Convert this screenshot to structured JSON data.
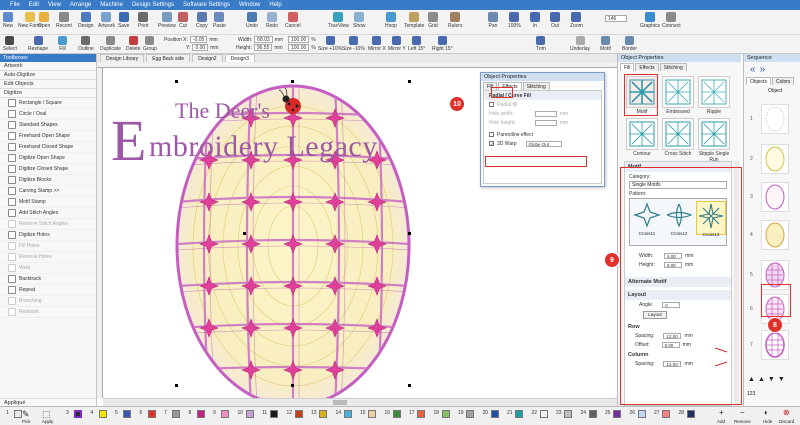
{
  "menubar": [
    "File",
    "Edit",
    "View",
    "Arrange",
    "Machine",
    "Design Settings",
    "Software Settings",
    "Window",
    "Help"
  ],
  "toolbar1": {
    "buttons": [
      "New",
      "New Form",
      "Open",
      "Recent",
      "Design",
      "Artwork",
      "Save",
      "Print",
      "Preview",
      "Cut",
      "Copy",
      "Paste",
      "Undo",
      "Redo",
      "Cancel",
      "TrueView",
      "Show",
      "Hoop",
      "Template",
      "Grid",
      "Rulers",
      "Pan",
      "100%",
      "In",
      "Out",
      "Zoom",
      "Graphics",
      "Connect"
    ],
    "zoom_value": "146"
  },
  "toolbar2": {
    "buttons": [
      "Select",
      "Reshape",
      "Fill",
      "Outline",
      "Duplicate",
      "Delete",
      "Group",
      "Size +10%",
      "Size -10%",
      "Mirror X",
      "Mirror Y",
      "Left 15°",
      "Right 15°",
      "Trim",
      "Underlay",
      "Motif",
      "Border"
    ],
    "position_x_label": "Position X:",
    "position_x": "-0.05",
    "position_y_label": "Y:",
    "position_y": "0.00",
    "width_label": "Width:",
    "width": "68.03",
    "height_label": "Height:",
    "height": "96.55",
    "unit": "mm",
    "scale_w": "100.00",
    "scale_h": "100.00",
    "scale_unit": "%"
  },
  "toolbox": {
    "title": "Toolboxes",
    "sections": [
      "Artwork",
      "Auto-Digitize",
      "Edit Objects",
      "Digitize"
    ],
    "items": [
      {
        "label": "Rectangle / Square",
        "disabled": false
      },
      {
        "label": "Circle / Oval",
        "disabled": false
      },
      {
        "label": "Standard Shapes",
        "disabled": false
      },
      {
        "label": "Freehand Open Shape",
        "disabled": false
      },
      {
        "label": "Freehand Closed Shape",
        "disabled": false
      },
      {
        "label": "Digitize Open Shape",
        "disabled": false
      },
      {
        "label": "Digitize Closed Shape",
        "disabled": false
      },
      {
        "label": "Digitize Blocks",
        "disabled": false
      },
      {
        "label": "Carving Stamp >>",
        "disabled": false
      },
      {
        "label": "Motif Stamp",
        "disabled": false
      },
      {
        "label": "Add Stitch Angles",
        "disabled": false
      },
      {
        "label": "Remove Stitch Angles",
        "disabled": true
      },
      {
        "label": "Digitize Holes",
        "disabled": false
      },
      {
        "label": "Fill Holes",
        "disabled": true
      },
      {
        "label": "Remove Holes",
        "disabled": true
      },
      {
        "label": "Weld",
        "disabled": true
      },
      {
        "label": "Backtrack",
        "disabled": false
      },
      {
        "label": "Repeat",
        "disabled": false
      },
      {
        "label": "Branching",
        "disabled": true
      },
      {
        "label": "Redwork",
        "disabled": true
      }
    ],
    "bottom_section": "Appliqué"
  },
  "doc_tabs": [
    "Design Library",
    "Egg Back side",
    "Design2",
    "Design3"
  ],
  "logo": {
    "line1": "The Deer's",
    "line2_initial": "E",
    "line2": "mbroidery Legacy"
  },
  "dialog": {
    "title": "Object Properties",
    "tabs": [
      "Fill",
      "Effects",
      "Stitching"
    ],
    "section": "Radial / Curve Fill",
    "radial_fill": "Radial fill",
    "hole_width": "Hole width:",
    "hole_height": "Hole height:",
    "hole_unit": "mm",
    "parentline": "Parentline effect",
    "warp_label": "3D Warp",
    "warp_value": "Globe Out"
  },
  "panel": {
    "title": "Object Properties",
    "tabs": [
      "Fill",
      "Effects",
      "Stitching"
    ],
    "types": [
      "Motif",
      "Embossed",
      "Ripple",
      "Contour",
      "Cross Stitch",
      "Stipple Single Run"
    ],
    "motif_header": "Motif",
    "category_label": "Category:",
    "category_value": "Single Motifs",
    "pattern_label": "Pattern:",
    "patterns": [
      "Cross11",
      "Cross12",
      "Cross13"
    ],
    "width_label": "Width:",
    "width_value": "6.00",
    "height_label": "Height:",
    "height_value": "6.00",
    "unit": "mm",
    "alternate_motif": "Alternate Motif",
    "layout": "Layout",
    "angle_label": "Angle:",
    "angle_value": "0",
    "layout_button": "Layout",
    "row_header": "Row",
    "spacing_label": "Spacing:",
    "row_spacing": "12.00",
    "offset_label": "Offset:",
    "row_offset": "0.00",
    "column_header": "Column",
    "col_spacing": "12.00"
  },
  "sequence": {
    "title": "Sequence",
    "tabs": [
      "Objects",
      "Colors"
    ],
    "header": "Object",
    "numbers": [
      "1",
      "2",
      "3",
      "4",
      "5",
      "6",
      "7"
    ],
    "zoom_value": "123"
  },
  "palette": {
    "numbers": [
      "1",
      "2",
      "3",
      "4",
      "5",
      "6",
      "7",
      "8",
      "9",
      "10",
      "11",
      "12",
      "13",
      "14",
      "15",
      "16",
      "17",
      "18",
      "19",
      "20",
      "21",
      "22",
      "23",
      "24",
      "25",
      "26",
      "27",
      "28"
    ],
    "colors": [
      "#e8e8e8",
      "#7ac142",
      "#2c2c2c",
      "#f2e600",
      "#3a56b0",
      "#e0302b",
      "#999999",
      "#c02080",
      "#e890c0",
      "#c8a0d8",
      "#1a1a1a",
      "#c04020",
      "#d8b020",
      "#4ab0e0",
      "#f0d0a0",
      "#3a8a3a",
      "#e86040",
      "#80c060",
      "#a0a0a0",
      "#2050a0",
      "#20a0a0",
      "#f0f0f0",
      "#c0c0c0",
      "#606060",
      "#7030a0",
      "#c0d8f0",
      "#f08080",
      "#203060"
    ],
    "buttons": [
      "Pick",
      "Apply",
      "Add",
      "Remove",
      "Hide",
      "Discard"
    ]
  },
  "badges": [
    "10",
    "9",
    "8"
  ]
}
